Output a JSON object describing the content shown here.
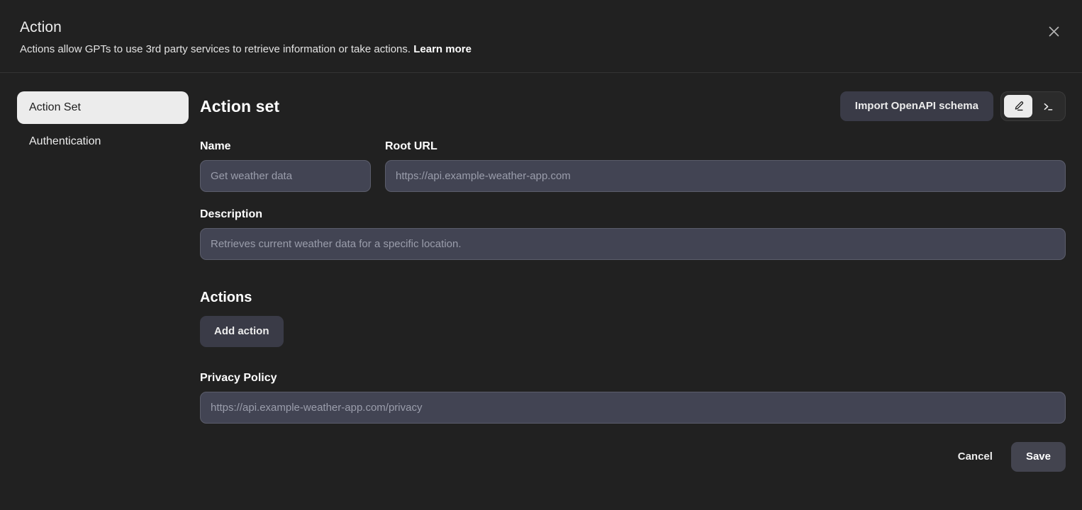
{
  "header": {
    "title": "Action",
    "subtitle": "Actions allow GPTs to use 3rd party services to retrieve information or take actions.",
    "learn_more_label": "Learn more",
    "close_icon": "close-icon"
  },
  "sidebar": {
    "items": [
      {
        "label": "Action Set",
        "active": true
      },
      {
        "label": "Authentication",
        "active": false
      }
    ]
  },
  "main": {
    "section_title": "Action set",
    "import_button_label": "Import OpenAPI schema",
    "view_toggle": [
      {
        "icon": "pencil-icon",
        "active": true
      },
      {
        "icon": "terminal-icon",
        "active": false
      }
    ],
    "fields": {
      "name": {
        "label": "Name",
        "value": "",
        "placeholder": "Get weather data"
      },
      "root_url": {
        "label": "Root URL",
        "value": "",
        "placeholder": "https://api.example-weather-app.com"
      },
      "description": {
        "label": "Description",
        "value": "",
        "placeholder": "Retrieves current weather data for a specific location."
      },
      "privacy_policy": {
        "label": "Privacy Policy",
        "value": "",
        "placeholder": "https://api.example-weather-app.com/privacy"
      }
    },
    "actions_section": {
      "heading": "Actions",
      "add_button_label": "Add action"
    }
  },
  "footer": {
    "cancel_label": "Cancel",
    "save_label": "Save"
  },
  "colors": {
    "background": "#212121",
    "field_background": "#424453",
    "button_background": "#3a3b47",
    "active_nav_background": "#ececec",
    "text_primary": "#ececec",
    "placeholder": "#9a9dab"
  }
}
